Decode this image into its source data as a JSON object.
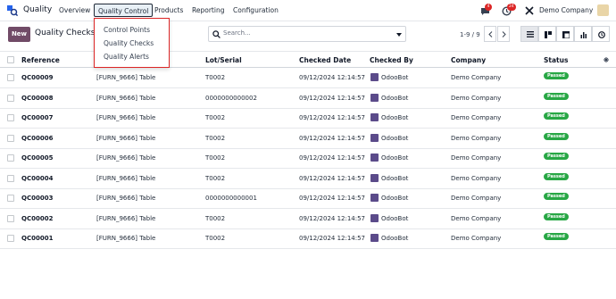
{
  "app": {
    "name": "Quality"
  },
  "nav": {
    "items": [
      "Overview",
      "Quality Control",
      "Products",
      "Reporting",
      "Configuration"
    ],
    "active_index": 1
  },
  "systray": {
    "messages_badge": "4",
    "activities_badge": "24",
    "company": "Demo Company"
  },
  "dropdown": {
    "items": [
      "Control Points",
      "Quality Checks",
      "Quality Alerts"
    ]
  },
  "control_panel": {
    "new_label": "New",
    "title": "Quality Checks",
    "search_placeholder": "Search...",
    "pager": "1-9 / 9"
  },
  "table": {
    "columns": [
      "Reference",
      "Lot/Serial",
      "Checked Date",
      "Checked By",
      "Company",
      "Status"
    ],
    "rows": [
      {
        "ref": "QC00009",
        "product": "[FURN_9666] Table",
        "lot": "T0002",
        "date": "09/12/2024 12:14:57",
        "by": "OdooBot",
        "company": "Demo Company",
        "status": "Passed"
      },
      {
        "ref": "QC00008",
        "product": "[FURN_9666] Table",
        "lot": "0000000000002",
        "date": "09/12/2024 12:14:57",
        "by": "OdooBot",
        "company": "Demo Company",
        "status": "Passed"
      },
      {
        "ref": "QC00007",
        "product": "[FURN_9666] Table",
        "lot": "T0002",
        "date": "09/12/2024 12:14:57",
        "by": "OdooBot",
        "company": "Demo Company",
        "status": "Passed"
      },
      {
        "ref": "QC00006",
        "product": "[FURN_9666] Table",
        "lot": "T0002",
        "date": "09/12/2024 12:14:57",
        "by": "OdooBot",
        "company": "Demo Company",
        "status": "Passed"
      },
      {
        "ref": "QC00005",
        "product": "[FURN_9666] Table",
        "lot": "T0002",
        "date": "09/12/2024 12:14:57",
        "by": "OdooBot",
        "company": "Demo Company",
        "status": "Passed"
      },
      {
        "ref": "QC00004",
        "product": "[FURN_9666] Table",
        "lot": "T0002",
        "date": "09/12/2024 12:14:57",
        "by": "OdooBot",
        "company": "Demo Company",
        "status": "Passed"
      },
      {
        "ref": "QC00003",
        "product": "[FURN_9666] Table",
        "lot": "0000000000001",
        "date": "09/12/2024 12:14:57",
        "by": "OdooBot",
        "company": "Demo Company",
        "status": "Passed"
      },
      {
        "ref": "QC00002",
        "product": "[FURN_9666] Table",
        "lot": "T0002",
        "date": "09/12/2024 12:14:57",
        "by": "OdooBot",
        "company": "Demo Company",
        "status": "Passed"
      },
      {
        "ref": "QC00001",
        "product": "[FURN_9666] Table",
        "lot": "T0002",
        "date": "09/12/2024 12:14:57",
        "by": "OdooBot",
        "company": "Demo Company",
        "status": "Passed"
      }
    ]
  },
  "colors": {
    "brand": "#714b67",
    "status_passed": "#28a745",
    "badge": "#dc2626"
  }
}
